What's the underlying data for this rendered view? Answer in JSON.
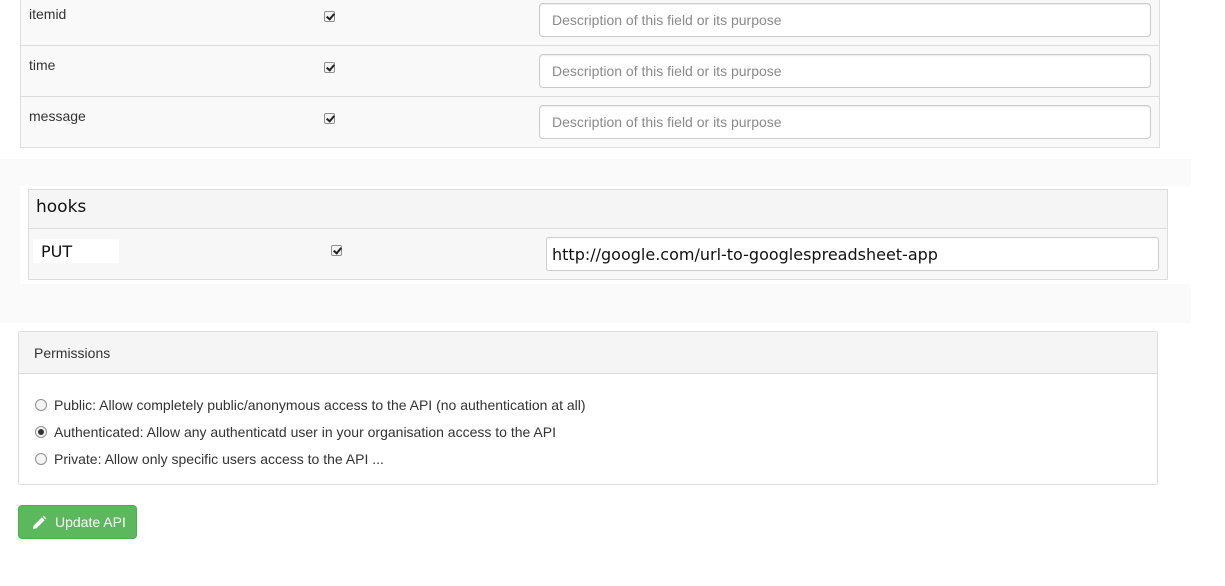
{
  "fields": [
    {
      "name": "itemid",
      "checked": true,
      "description_placeholder": "Description of this field or its purpose"
    },
    {
      "name": "time",
      "checked": true,
      "description_placeholder": "Description of this field or its purpose"
    },
    {
      "name": "message",
      "checked": true,
      "description_placeholder": "Description of this field or its purpose"
    }
  ],
  "hooks": {
    "title": "hooks",
    "method": "PUT",
    "enabled": true,
    "url": "http://google.com/url-to-googlespreadsheet-app"
  },
  "permissions": {
    "title": "Permissions",
    "options": [
      {
        "label": "Public: Allow completely public/anonymous access to the API (no authentication at all)",
        "checked": false
      },
      {
        "label": "Authenticated: Allow any authenticatd user in your organisation access to the API",
        "checked": true
      },
      {
        "label": "Private: Allow only specific users access to the API ...",
        "checked": false
      }
    ]
  },
  "actions": {
    "update_label": "Update API",
    "update_icon": "pencil-icon"
  },
  "colors": {
    "success": "#5cb85c",
    "border": "#dddddd",
    "panel_header": "#f5f5f5"
  }
}
